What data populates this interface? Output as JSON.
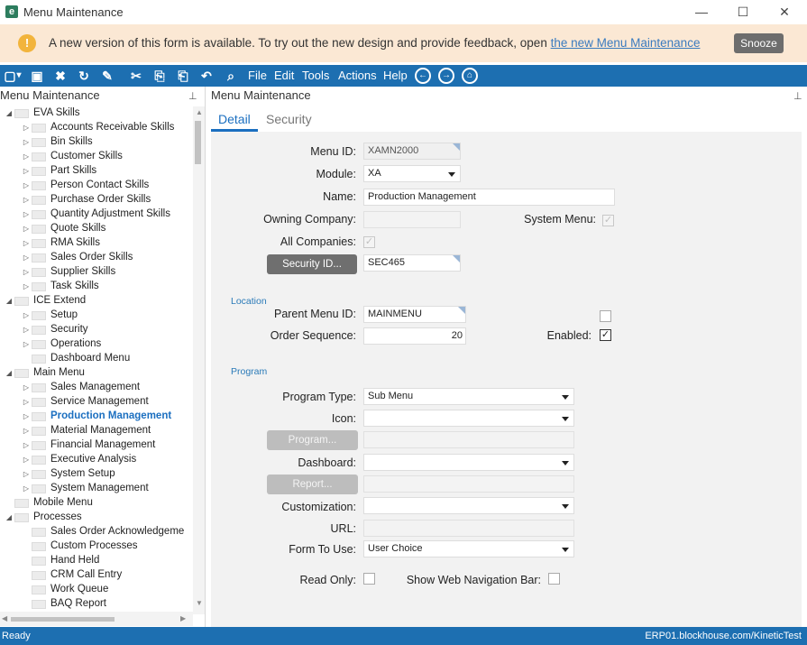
{
  "window": {
    "title": "Menu Maintenance",
    "app_icon": "e",
    "minimize": "—",
    "maximize": "☐",
    "close": "✕"
  },
  "banner": {
    "text": "A new version of this form is available. To try out the new design and provide feedback, open ",
    "link": "the new Menu Maintenance",
    "snooze": "Snooze",
    "warn_icon": "!"
  },
  "toolbar": {
    "icons": {
      "new": "▢",
      "new_arrow": "▾",
      "save": "▣",
      "delete": "✖",
      "refresh": "↻",
      "clear": "✎",
      "cut": "✂",
      "copy": "⎘",
      "paste": "⎗",
      "undo": "↶",
      "search": "⌕",
      "back": "←",
      "forward": "→",
      "home": "⌂"
    },
    "menus": [
      "File",
      "Edit",
      "Tools",
      "Actions",
      "Help"
    ]
  },
  "tree_panel": {
    "title": "Menu Maintenance",
    "pin": "⊥",
    "rows": [
      {
        "label": "EVA Skills",
        "level": 0,
        "exp": "◢"
      },
      {
        "label": "Accounts Receivable Skills",
        "level": 1,
        "exp": "▷"
      },
      {
        "label": "Bin Skills",
        "level": 1,
        "exp": "▷"
      },
      {
        "label": "Customer Skills",
        "level": 1,
        "exp": "▷"
      },
      {
        "label": "Part Skills",
        "level": 1,
        "exp": "▷"
      },
      {
        "label": "Person Contact Skills",
        "level": 1,
        "exp": "▷"
      },
      {
        "label": "Purchase Order Skills",
        "level": 1,
        "exp": "▷"
      },
      {
        "label": "Quantity Adjustment Skills",
        "level": 1,
        "exp": "▷"
      },
      {
        "label": "Quote Skills",
        "level": 1,
        "exp": "▷"
      },
      {
        "label": "RMA Skills",
        "level": 1,
        "exp": "▷"
      },
      {
        "label": "Sales Order Skills",
        "level": 1,
        "exp": "▷"
      },
      {
        "label": "Supplier Skills",
        "level": 1,
        "exp": "▷"
      },
      {
        "label": "Task Skills",
        "level": 1,
        "exp": "▷"
      },
      {
        "label": "ICE Extend",
        "level": 0,
        "exp": "◢"
      },
      {
        "label": "Setup",
        "level": 1,
        "exp": "▷"
      },
      {
        "label": "Security",
        "level": 1,
        "exp": "▷"
      },
      {
        "label": "Operations",
        "level": 1,
        "exp": "▷"
      },
      {
        "label": "Dashboard Menu",
        "level": 1,
        "exp": ""
      },
      {
        "label": "Main Menu",
        "level": 0,
        "exp": "◢"
      },
      {
        "label": "Sales Management",
        "level": 1,
        "exp": "▷"
      },
      {
        "label": "Service Management",
        "level": 1,
        "exp": "▷"
      },
      {
        "label": "Production Management",
        "level": 1,
        "exp": "▷",
        "selected": true
      },
      {
        "label": "Material Management",
        "level": 1,
        "exp": "▷"
      },
      {
        "label": "Financial Management",
        "level": 1,
        "exp": "▷"
      },
      {
        "label": "Executive Analysis",
        "level": 1,
        "exp": "▷"
      },
      {
        "label": "System Setup",
        "level": 1,
        "exp": "▷"
      },
      {
        "label": "System Management",
        "level": 1,
        "exp": "▷"
      },
      {
        "label": "Mobile Menu",
        "level": 0,
        "exp": ""
      },
      {
        "label": "Processes",
        "level": 0,
        "exp": "◢"
      },
      {
        "label": "Sales Order Acknowledgeme",
        "level": 1,
        "exp": ""
      },
      {
        "label": "Custom Processes",
        "level": 1,
        "exp": ""
      },
      {
        "label": "Hand Held",
        "level": 1,
        "exp": ""
      },
      {
        "label": "CRM Call Entry",
        "level": 1,
        "exp": ""
      },
      {
        "label": "Work Queue",
        "level": 1,
        "exp": ""
      },
      {
        "label": "BAQ Report",
        "level": 1,
        "exp": ""
      }
    ],
    "scroll_up": "▲",
    "scroll_down": "▼",
    "scroll_left": "◀",
    "scroll_right": "▶"
  },
  "detail_panel": {
    "title": "Menu Maintenance",
    "pin": "⊥",
    "tabs": {
      "detail": "Detail",
      "security": "Security"
    },
    "labels": {
      "menu_id": "Menu ID:",
      "module": "Module:",
      "name": "Name:",
      "owning_company": "Owning Company:",
      "system_menu": "System Menu:",
      "all_companies": "All Companies:",
      "parent_menu_id": "Parent Menu ID:",
      "order_sequence": "Order Sequence:",
      "enabled": "Enabled:",
      "program_type": "Program Type:",
      "icon": "Icon:",
      "dashboard": "Dashboard:",
      "customization": "Customization:",
      "url": "URL:",
      "form_to_use": "Form To Use:",
      "read_only": "Read Only:",
      "show_web_nav": "Show Web Navigation Bar:"
    },
    "values": {
      "menu_id": "XAMN2000",
      "module": "XA",
      "name": "Production Management",
      "owning_company": "",
      "security_id": "SEC465",
      "parent_menu_id": "MAINMENU",
      "order_sequence": "20",
      "program_type": "Sub Menu",
      "icon": "",
      "program": "",
      "dashboard": "",
      "report": "",
      "customization": "",
      "url": "",
      "form_to_use": "User Choice"
    },
    "checks": {
      "system_menu": "✓",
      "all_companies": "✓",
      "enabled": "✓",
      "location_flag": "",
      "read_only": "",
      "show_web_nav": ""
    },
    "buttons": {
      "security_id": "Security ID...",
      "program": "Program...",
      "report": "Report..."
    },
    "sections": {
      "location": "Location",
      "program": "Program"
    }
  },
  "status": {
    "left": "Ready",
    "right": "ERP01.blockhouse.com/KineticTest"
  }
}
